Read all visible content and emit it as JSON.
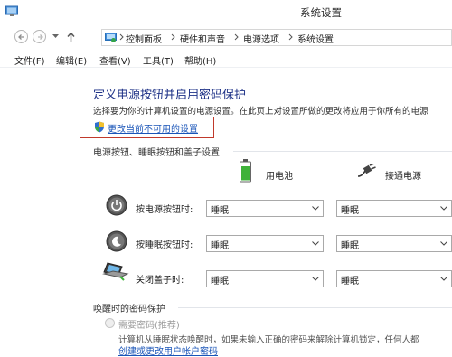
{
  "window": {
    "title": "系统设置"
  },
  "address": {
    "crumbs": [
      "控制面板",
      "硬件和声音",
      "电源选项",
      "系统设置"
    ]
  },
  "menu": {
    "items": [
      "文件(F)",
      "编辑(E)",
      "查看(V)",
      "工具(T)",
      "帮助(H)"
    ]
  },
  "main": {
    "heading": "定义电源按钮并启用密码保护",
    "description": "选择要为你的计算机设置的电源设置。在此页上对设置所做的更改将应用于你所有的电源",
    "change_link": "更改当前不可用的设置",
    "section_buttons": "电源按钮、睡眠按钮和盖子设置",
    "columns": {
      "battery": "用电池",
      "plugged": "接通电源"
    },
    "rows": [
      {
        "label": "按电源按钮时:",
        "battery": "睡眠",
        "plugged": "睡眠",
        "icon": "power-button-icon"
      },
      {
        "label": "按睡眠按钮时:",
        "battery": "睡眠",
        "plugged": "睡眠",
        "icon": "sleep-button-icon"
      },
      {
        "label": "关闭盖子时:",
        "battery": "睡眠",
        "plugged": "睡眠",
        "icon": "laptop-lid-icon"
      }
    ],
    "section_password": "唤醒时的密码保护",
    "require_password": "需要密码(推荐)",
    "password_desc": "计算机从睡眠状态唤醒时，如果未输入正确的密码来解除计算机锁定，任何人都",
    "create_link": "创建或更改用户帐户密码"
  },
  "colors": {
    "link": "#1a55b8",
    "heading": "#1e3287",
    "highlight": "#c0392b"
  }
}
